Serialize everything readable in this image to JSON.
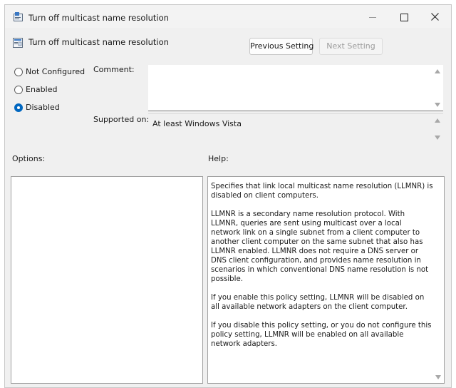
{
  "window": {
    "title": "Turn off multicast name resolution"
  },
  "header": {
    "policy_name": "Turn off multicast name resolution",
    "previous_label": "Previous Setting",
    "next_label": "Next Setting"
  },
  "state": {
    "options": [
      "Not Configured",
      "Enabled",
      "Disabled"
    ],
    "selected": "Disabled"
  },
  "labels": {
    "comment": "Comment:",
    "supported_on": "Supported on:",
    "options": "Options:",
    "help": "Help:"
  },
  "comment": {
    "value": ""
  },
  "supported_on": {
    "value": "At least Windows Vista"
  },
  "help": {
    "paragraphs": [
      "Specifies that link local multicast name resolution (LLMNR) is disabled on client computers.",
      "LLMNR is a secondary name resolution protocol. With LLMNR, queries are sent using multicast over a local network link on a single subnet from a client computer to another client computer on the same subnet that also has LLMNR enabled. LLMNR does not require a DNS server or DNS client configuration, and provides name resolution in scenarios in which conventional DNS name resolution is not possible.",
      "If you enable this policy setting, LLMNR will be disabled on all available network adapters on the client computer.",
      "If you disable this policy setting, or you do not configure this policy setting, LLMNR will be enabled on all available network adapters."
    ]
  },
  "colors": {
    "accent": "#0067c0",
    "window_bg": "#f0f0f0"
  },
  "icons": {
    "app": "policy-app-icon",
    "policy": "policy-setting-icon",
    "minimize": "minimize-icon",
    "maximize": "maximize-icon",
    "close": "close-icon"
  }
}
